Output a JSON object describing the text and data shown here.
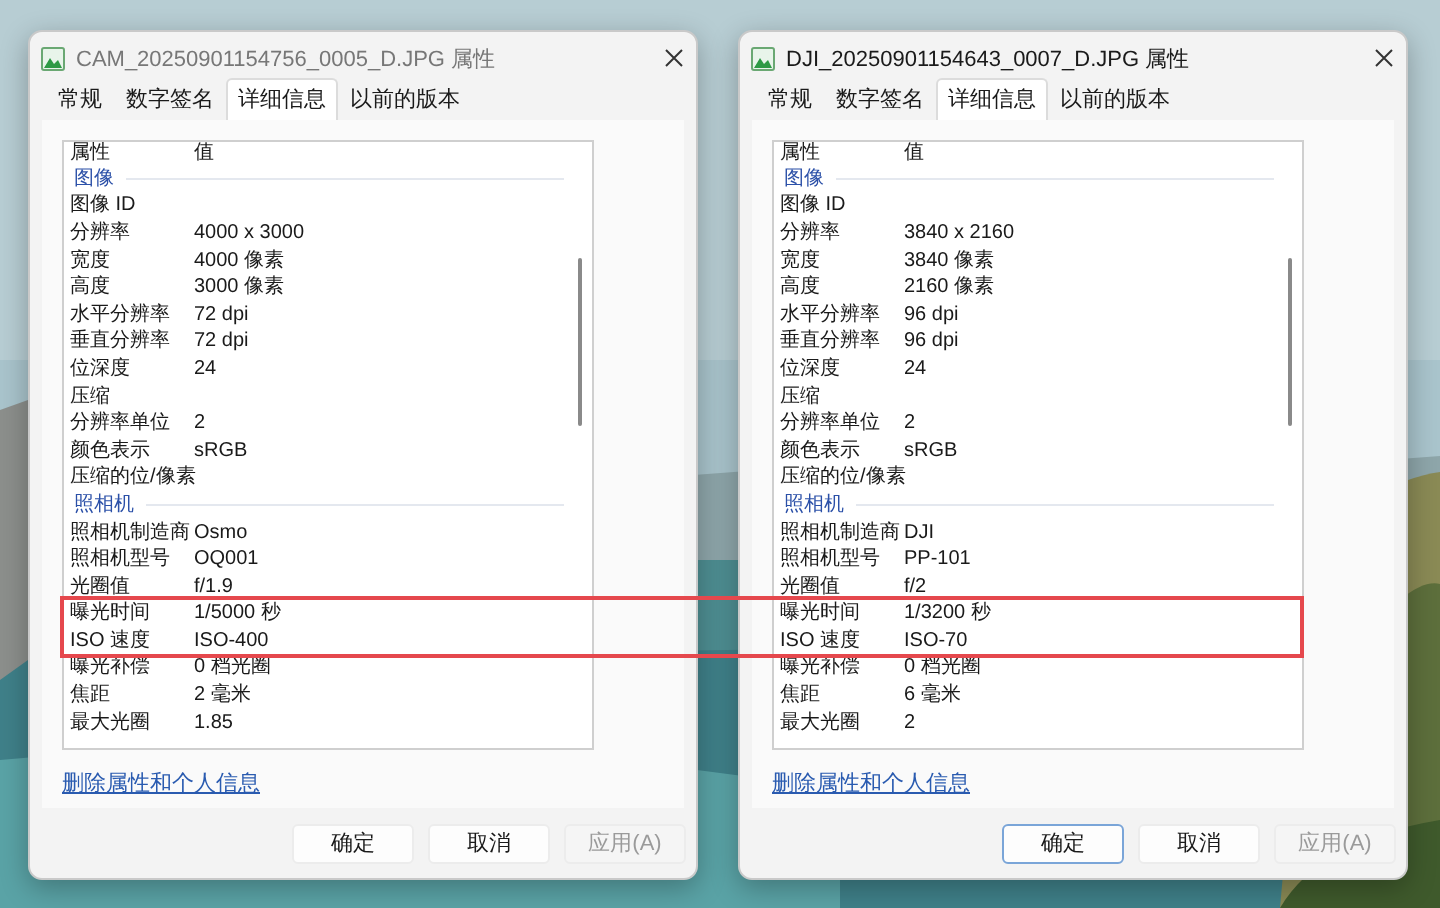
{
  "annotation": {
    "kind": "rectangle",
    "color": "#e5484d"
  },
  "windows": [
    {
      "title": "CAM_20250901154756_0005_D.JPG 属性",
      "tabs": [
        {
          "label": "常规",
          "selected": false
        },
        {
          "label": "数字签名",
          "selected": false
        },
        {
          "label": "详细信息",
          "selected": true
        },
        {
          "label": "以前的版本",
          "selected": false
        }
      ],
      "columns": [
        "属性",
        "值"
      ],
      "rows": [
        {
          "kind": "group",
          "name": "图像"
        },
        {
          "kind": "item",
          "name": "图像 ID"
        },
        {
          "kind": "item",
          "name": "分辨率",
          "value": "4000 x 3000"
        },
        {
          "kind": "item",
          "name": "宽度",
          "value": "4000 像素"
        },
        {
          "kind": "item",
          "name": "高度",
          "value": "3000 像素"
        },
        {
          "kind": "item",
          "name": "水平分辨率",
          "value": "72 dpi"
        },
        {
          "kind": "item",
          "name": "垂直分辨率",
          "value": "72 dpi"
        },
        {
          "kind": "item",
          "name": "位深度",
          "value": "24"
        },
        {
          "kind": "item",
          "name": "压缩"
        },
        {
          "kind": "item",
          "name": "分辨率单位",
          "value": "2"
        },
        {
          "kind": "item",
          "name": "颜色表示",
          "value": "sRGB"
        },
        {
          "kind": "item",
          "name": "压缩的位/像素"
        },
        {
          "kind": "group",
          "name": "照相机"
        },
        {
          "kind": "item",
          "name": "照相机制造商",
          "value": "Osmo"
        },
        {
          "kind": "item",
          "name": "照相机型号",
          "value": "OQ001"
        },
        {
          "kind": "item",
          "name": "光圈值",
          "value": "f/1.9"
        },
        {
          "kind": "item",
          "name": "曝光时间",
          "value": "1/5000 秒"
        },
        {
          "kind": "item",
          "name": "ISO 速度",
          "value": "ISO-400"
        },
        {
          "kind": "item",
          "name": "曝光补偿",
          "value": "0 档光圈"
        },
        {
          "kind": "item",
          "name": "焦距",
          "value": "2 毫米"
        },
        {
          "kind": "item",
          "name": "最大光圈",
          "value": "1.85"
        }
      ],
      "link": "删除属性和个人信息",
      "buttons": [
        {
          "label": "确定",
          "default": false,
          "disabled": false
        },
        {
          "label": "取消",
          "default": false,
          "disabled": false
        },
        {
          "label": "应用(A)",
          "default": false,
          "disabled": true
        }
      ]
    },
    {
      "title": "DJI_20250901154643_0007_D.JPG 属性",
      "tabs": [
        {
          "label": "常规",
          "selected": false
        },
        {
          "label": "数字签名",
          "selected": false
        },
        {
          "label": "详细信息",
          "selected": true
        },
        {
          "label": "以前的版本",
          "selected": false
        }
      ],
      "columns": [
        "属性",
        "值"
      ],
      "rows": [
        {
          "kind": "group",
          "name": "图像"
        },
        {
          "kind": "item",
          "name": "图像 ID"
        },
        {
          "kind": "item",
          "name": "分辨率",
          "value": "3840 x 2160"
        },
        {
          "kind": "item",
          "name": "宽度",
          "value": "3840 像素"
        },
        {
          "kind": "item",
          "name": "高度",
          "value": "2160 像素"
        },
        {
          "kind": "item",
          "name": "水平分辨率",
          "value": "96 dpi"
        },
        {
          "kind": "item",
          "name": "垂直分辨率",
          "value": "96 dpi"
        },
        {
          "kind": "item",
          "name": "位深度",
          "value": "24"
        },
        {
          "kind": "item",
          "name": "压缩"
        },
        {
          "kind": "item",
          "name": "分辨率单位",
          "value": "2"
        },
        {
          "kind": "item",
          "name": "颜色表示",
          "value": "sRGB"
        },
        {
          "kind": "item",
          "name": "压缩的位/像素"
        },
        {
          "kind": "group",
          "name": "照相机"
        },
        {
          "kind": "item",
          "name": "照相机制造商",
          "value": "DJI"
        },
        {
          "kind": "item",
          "name": "照相机型号",
          "value": "PP-101"
        },
        {
          "kind": "item",
          "name": "光圈值",
          "value": "f/2"
        },
        {
          "kind": "item",
          "name": "曝光时间",
          "value": "1/3200 秒"
        },
        {
          "kind": "item",
          "name": "ISO 速度",
          "value": "ISO-70"
        },
        {
          "kind": "item",
          "name": "曝光补偿",
          "value": "0 档光圈"
        },
        {
          "kind": "item",
          "name": "焦距",
          "value": "6 毫米"
        },
        {
          "kind": "item",
          "name": "最大光圈",
          "value": "2"
        }
      ],
      "link": "删除属性和个人信息",
      "buttons": [
        {
          "label": "确定",
          "default": true,
          "disabled": false
        },
        {
          "label": "取消",
          "default": false,
          "disabled": false
        },
        {
          "label": "应用(A)",
          "default": false,
          "disabled": true
        }
      ]
    }
  ]
}
